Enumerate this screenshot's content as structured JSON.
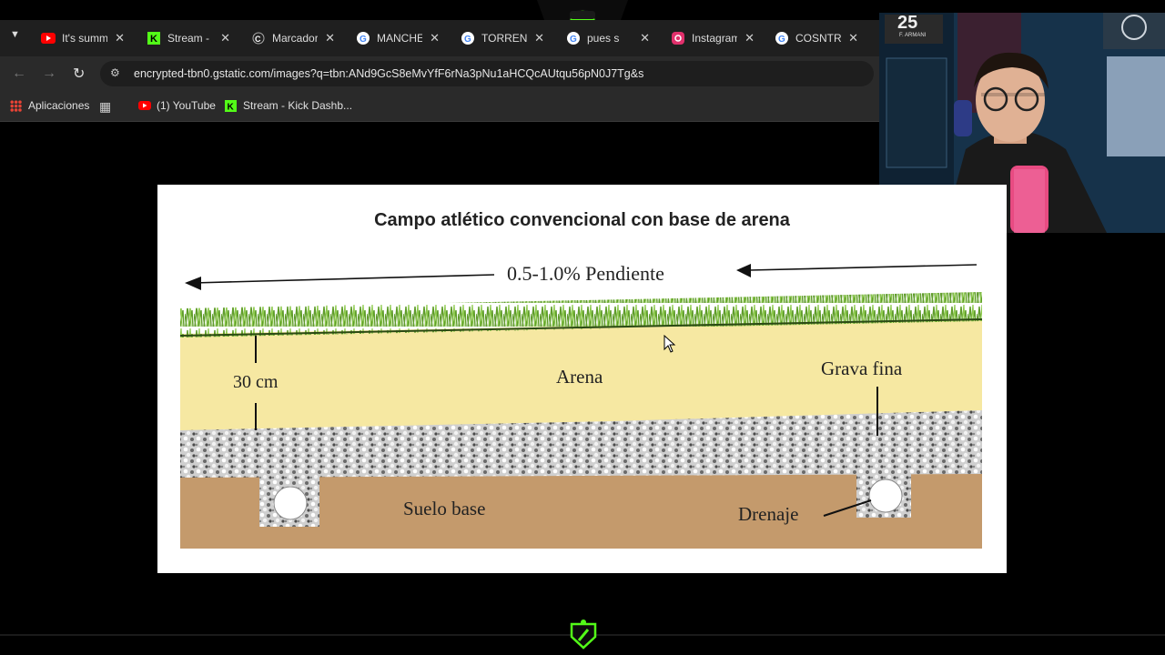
{
  "tabs": [
    {
      "icon": "youtube-icon",
      "label": "It's summ",
      "color": "#ff0000"
    },
    {
      "icon": "kick-icon",
      "label": "Stream - I",
      "color": "#53fc18"
    },
    {
      "icon": "marcador-icon",
      "label": "Marcador",
      "color": "#ffffff"
    },
    {
      "icon": "google-icon",
      "label": "MANCHE",
      "color": "#4285f4"
    },
    {
      "icon": "google-icon",
      "label": "TORRENT",
      "color": "#4285f4"
    },
    {
      "icon": "google-icon",
      "label": "pues s",
      "color": "#4285f4"
    },
    {
      "icon": "instagram-icon",
      "label": "Instagram",
      "color": "#e1306c"
    },
    {
      "icon": "google-icon",
      "label": "COSNTRU",
      "color": "#4285f4"
    }
  ],
  "address": {
    "url": "encrypted-tbn0.gstatic.com/images?q=tbn:ANd9GcS8eMvYfF6rNa3pNu1aHCQcAUtqu56pN0J7Tg&s"
  },
  "bookmarks": [
    {
      "icon": "apps-grid-icon",
      "label": "Aplicaciones"
    },
    {
      "icon": "tab-groups-icon",
      "label": ""
    },
    {
      "icon": "youtube-icon",
      "label": "(1) YouTube"
    },
    {
      "icon": "kick-icon",
      "label": "Stream - Kick Dashb..."
    }
  ],
  "figure": {
    "title": "Campo atlético convencional con base de arena",
    "slope": "0.5-1.0% Pendiente",
    "depth": "30 cm",
    "sand": "Arena",
    "gravel": "Grava fina",
    "base": "Suelo base",
    "drain": "Drenaje"
  },
  "webcam": {
    "jersey_number": "25",
    "jersey_name": "F. ARMANI"
  },
  "colors": {
    "accent": "#53fc18",
    "sand": "#f6e8a2",
    "soil": "#c49a6c",
    "grass": "#7cbf3a"
  }
}
